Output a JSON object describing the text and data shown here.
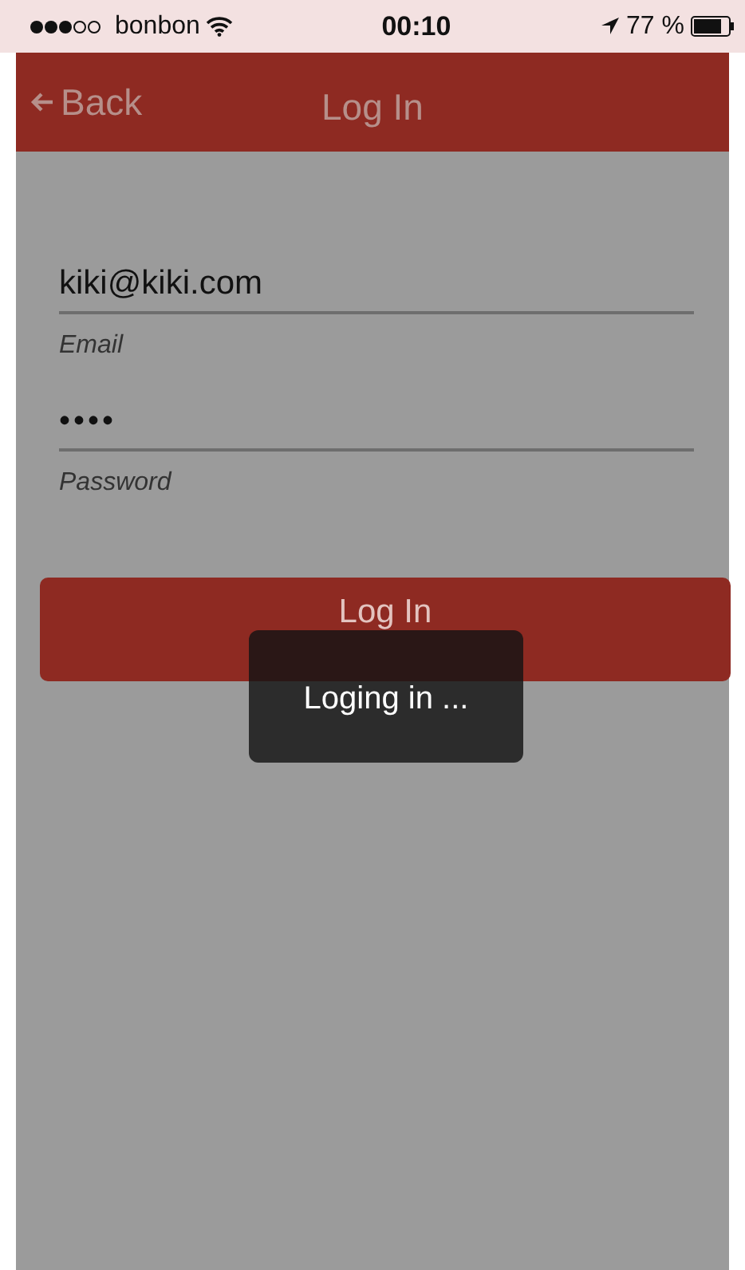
{
  "status_bar": {
    "carrier": "bonbon",
    "time": "00:10",
    "battery": "77 %"
  },
  "nav_bar": {
    "back": "Back",
    "title": "Log In"
  },
  "form": {
    "fields": [
      {
        "value": "kiki@kiki.com",
        "label": "Email",
        "kind": "text"
      },
      {
        "value": "••••",
        "label": "Password",
        "kind": "password"
      }
    ],
    "button": "Log In"
  },
  "toast": {
    "text": "Loging in ..."
  }
}
